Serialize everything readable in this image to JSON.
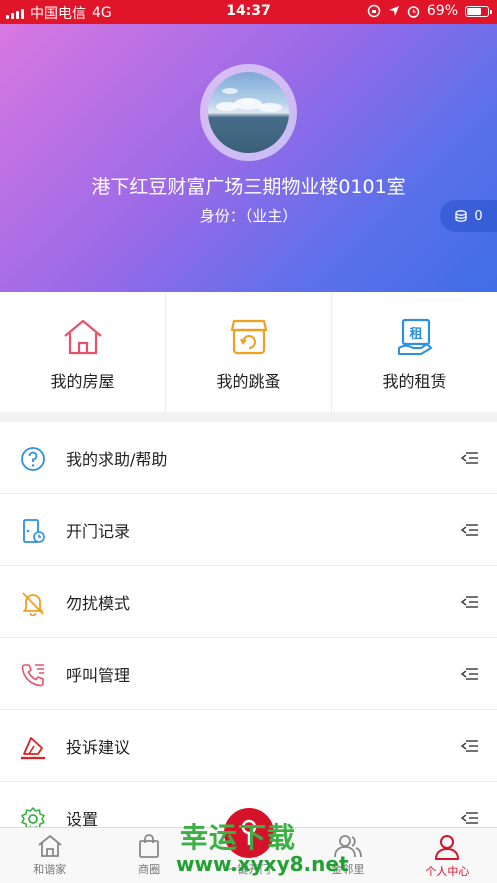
{
  "status_bar": {
    "carrier": "中国电信",
    "network": "4G",
    "time": "14:37",
    "battery_text": "69%",
    "battery_level": 0.69
  },
  "profile": {
    "address": "港下红豆财富广场三期物业楼0101室",
    "identity": "身份：（业主）",
    "points": "0"
  },
  "shortcuts": [
    {
      "label": "我的房屋",
      "icon": "house-icon",
      "color": "#e8516b"
    },
    {
      "label": "我的跳蚤",
      "icon": "market-icon",
      "color": "#f0a020"
    },
    {
      "label": "我的租赁",
      "icon": "rent-icon",
      "color": "#2c8fe0"
    }
  ],
  "menu": [
    {
      "label": "我的求助/帮助",
      "icon": "help-icon",
      "color": "#2c8fe0"
    },
    {
      "label": "开门记录",
      "icon": "door-record-icon",
      "color": "#2c8fe0"
    },
    {
      "label": "勿扰模式",
      "icon": "bell-off-icon",
      "color": "#f0a020"
    },
    {
      "label": "呼叫管理",
      "icon": "phone-icon",
      "color": "#e8516b"
    },
    {
      "label": "投诉建议",
      "icon": "complaint-icon",
      "color": "#e02020"
    },
    {
      "label": "设置",
      "icon": "settings-icon",
      "color": "#3cb043"
    }
  ],
  "tabbar": [
    {
      "label": "和谐家",
      "icon": "home-icon",
      "active": false
    },
    {
      "label": "商圈",
      "icon": "shopping-bag-icon",
      "active": false
    },
    {
      "label": "一键开门",
      "icon": "key-icon",
      "active": false
    },
    {
      "label": "金邻里",
      "icon": "neighbors-icon",
      "active": false
    },
    {
      "label": "个人中心",
      "icon": "person-icon",
      "active": true
    }
  ],
  "watermark": {
    "line1": "幸运下载",
    "line2": "www.xyxy8.net"
  },
  "colors": {
    "status_bar": "#e0152a",
    "accent": "#d4132a",
    "header_start": "#d878e0",
    "header_end": "#3f6ee6"
  }
}
